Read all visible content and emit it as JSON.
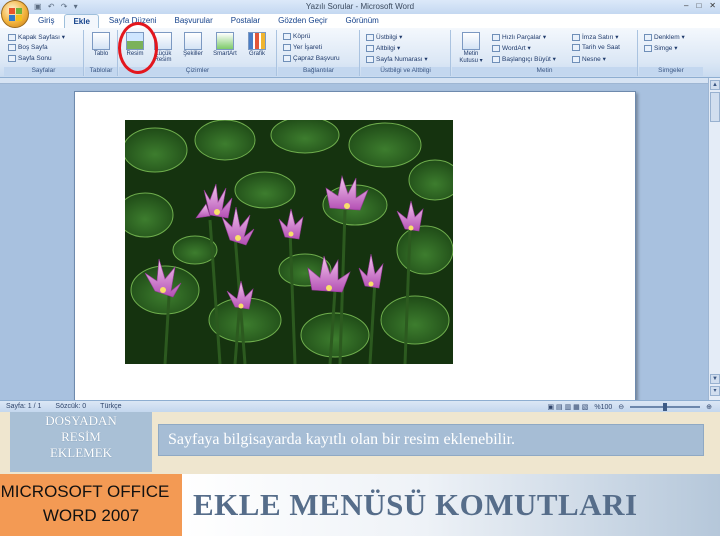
{
  "window": {
    "title": "Yazılı Sorular - Microsoft Word",
    "quick_access": "▣ ↶ ↷ ▾",
    "controls": [
      "–",
      "□",
      "✕"
    ]
  },
  "ribbon": {
    "tabs": [
      "Giriş",
      "Ekle",
      "Sayfa Düzeni",
      "Başvurular",
      "Postalar",
      "Gözden Geçir",
      "Görünüm"
    ],
    "active_tab": "Ekle",
    "groups": {
      "sayfalar": {
        "label": "Sayfalar",
        "items": [
          "Kapak Sayfası ▾",
          "Boş Sayfa",
          "Sayfa Sonu"
        ]
      },
      "tablolar": {
        "label": "Tablolar",
        "items": [
          "Tablo"
        ]
      },
      "cizimler": {
        "label": "Çizimler",
        "items": [
          "Resim",
          "Küçük Resim",
          "Şekiller",
          "SmartArt",
          "Grafik"
        ]
      },
      "baglantilar": {
        "label": "Bağlantılar",
        "items": [
          "Köprü",
          "Yer İşareti",
          "Çapraz Başvuru"
        ]
      },
      "ustbilgi": {
        "label": "Üstbilgi ve Altbilgi",
        "items": [
          "Üstbilgi ▾",
          "Altbilgi ▾",
          "Sayfa Numarası ▾"
        ]
      },
      "metin": {
        "label": "Metin",
        "items": [
          "Metin Kutusu ▾",
          "Hızlı Parçalar ▾",
          "WordArt ▾",
          "Başlangıçı Büyüt ▾",
          "İmza Satırı ▾",
          "Tarih ve Saat",
          "Nesne ▾"
        ]
      },
      "simgeler": {
        "label": "Simgeler",
        "items": [
          "Denklem ▾",
          "Simge ▾"
        ]
      }
    }
  },
  "statusbar": {
    "page": "Sayfa: 1 / 1",
    "words": "Sözcük: 0",
    "language": "Türkçe",
    "zoom": "%100"
  },
  "slide": {
    "label_lines": [
      "DOSYADAN",
      "RESİM",
      "EKLEMEK"
    ],
    "description": "Sayfaya bilgisayarda kayıtlı olan bir resim eklenebilir.",
    "product_lines": [
      "MICROSOFT OFFICE",
      "WORD 2007"
    ],
    "heading": "EKLE MENÜSÜ KOMUTLARI"
  },
  "colors": {
    "highlight_circle": "#e3161d",
    "label_box": "#a9c0d6",
    "product_box": "#f39a54",
    "heading_text": "#566d8a"
  }
}
